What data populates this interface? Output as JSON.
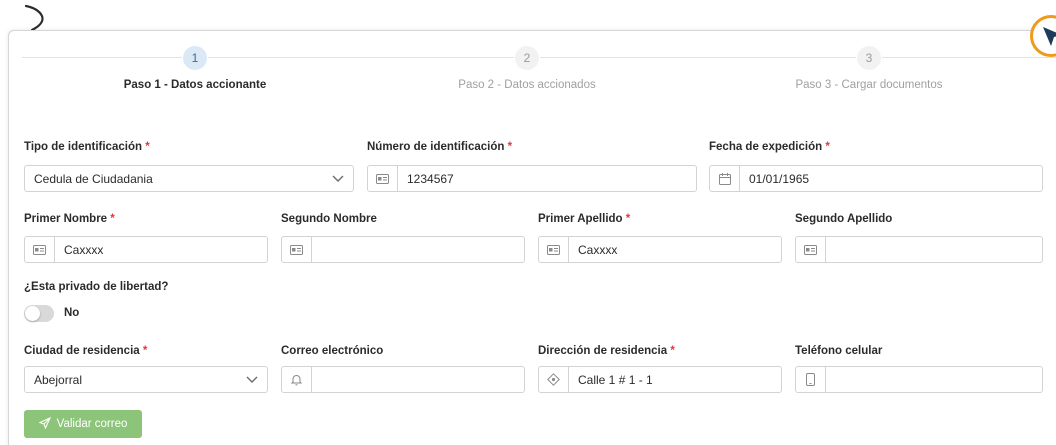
{
  "stepper": {
    "steps": [
      {
        "number": "1",
        "label": "Paso 1 - Datos accionante",
        "state": "active"
      },
      {
        "number": "2",
        "label": "Paso 2 - Datos accionados",
        "state": "inactive"
      },
      {
        "number": "3",
        "label": "Paso 3 - Cargar documentos",
        "state": "inactive"
      }
    ]
  },
  "form": {
    "tipo_id": {
      "label": "Tipo de identificación",
      "required": "*",
      "value": "Cedula de Ciudadania"
    },
    "numero_id": {
      "label": "Número de identificación",
      "required": "*",
      "value": "1234567",
      "icon": "id-card-icon"
    },
    "fecha_exp": {
      "label": "Fecha de expedición",
      "required": "*",
      "value": "01/01/1965",
      "icon": "calendar-icon"
    },
    "primer_nombre": {
      "label": "Primer Nombre",
      "required": "*",
      "value": "Caxxxx",
      "icon": "id-card-icon"
    },
    "segundo_nombre": {
      "label": "Segundo Nombre",
      "value": "",
      "icon": "id-card-icon"
    },
    "primer_apellido": {
      "label": "Primer Apellido",
      "required": "*",
      "value": "Caxxxx",
      "icon": "id-card-icon"
    },
    "segundo_apellido": {
      "label": "Segundo Apellido",
      "value": "",
      "icon": "id-card-icon"
    },
    "privado": {
      "label": "¿Esta privado de libertad?",
      "value_text": "No",
      "on": false
    },
    "ciudad": {
      "label": "Ciudad de residencia",
      "required": "*",
      "value": "Abejorral"
    },
    "correo": {
      "label": "Correo electrónico",
      "value": "",
      "icon": "bell-icon"
    },
    "direccion": {
      "label": "Dirección de residencia",
      "required": "*",
      "value": "Calle 1 # 1 - 1",
      "icon": "location-icon"
    },
    "telefono": {
      "label": "Teléfono celular",
      "value": "",
      "icon": "mobile-icon"
    }
  },
  "actions": {
    "validate_label": "Validar correo",
    "validate_icon": "send-icon"
  },
  "colors": {
    "accent": "#8cc47a",
    "step_active": "#dbe9f7",
    "required": "#e0383e",
    "badge_border": "#f09a1a"
  }
}
